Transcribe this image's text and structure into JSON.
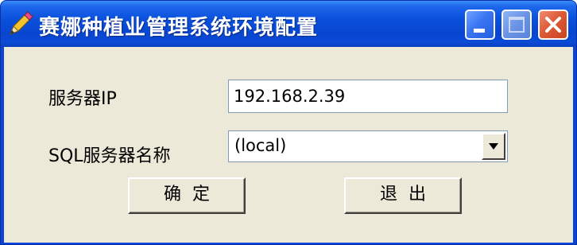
{
  "window": {
    "title": "赛娜种植业管理系统环境配置",
    "app_icon": "pencil-icon",
    "controls": {
      "minimize_icon": "minimize-icon",
      "maximize_icon": "maximize-icon",
      "close_icon": "close-icon"
    }
  },
  "form": {
    "server_ip": {
      "label": "服务器IP",
      "value": "192.168.2.39"
    },
    "sql_server_name": {
      "label": "SQL服务器名称",
      "selected": "(local)",
      "arrow_icon": "chevron-down-icon"
    }
  },
  "buttons": {
    "ok_label": "确定",
    "exit_label": "退出"
  },
  "colors": {
    "titlebar": "#0a50dc",
    "client_bg": "#ece9d8",
    "close_button": "#dd5a36",
    "field_border": "#7f9db9"
  }
}
